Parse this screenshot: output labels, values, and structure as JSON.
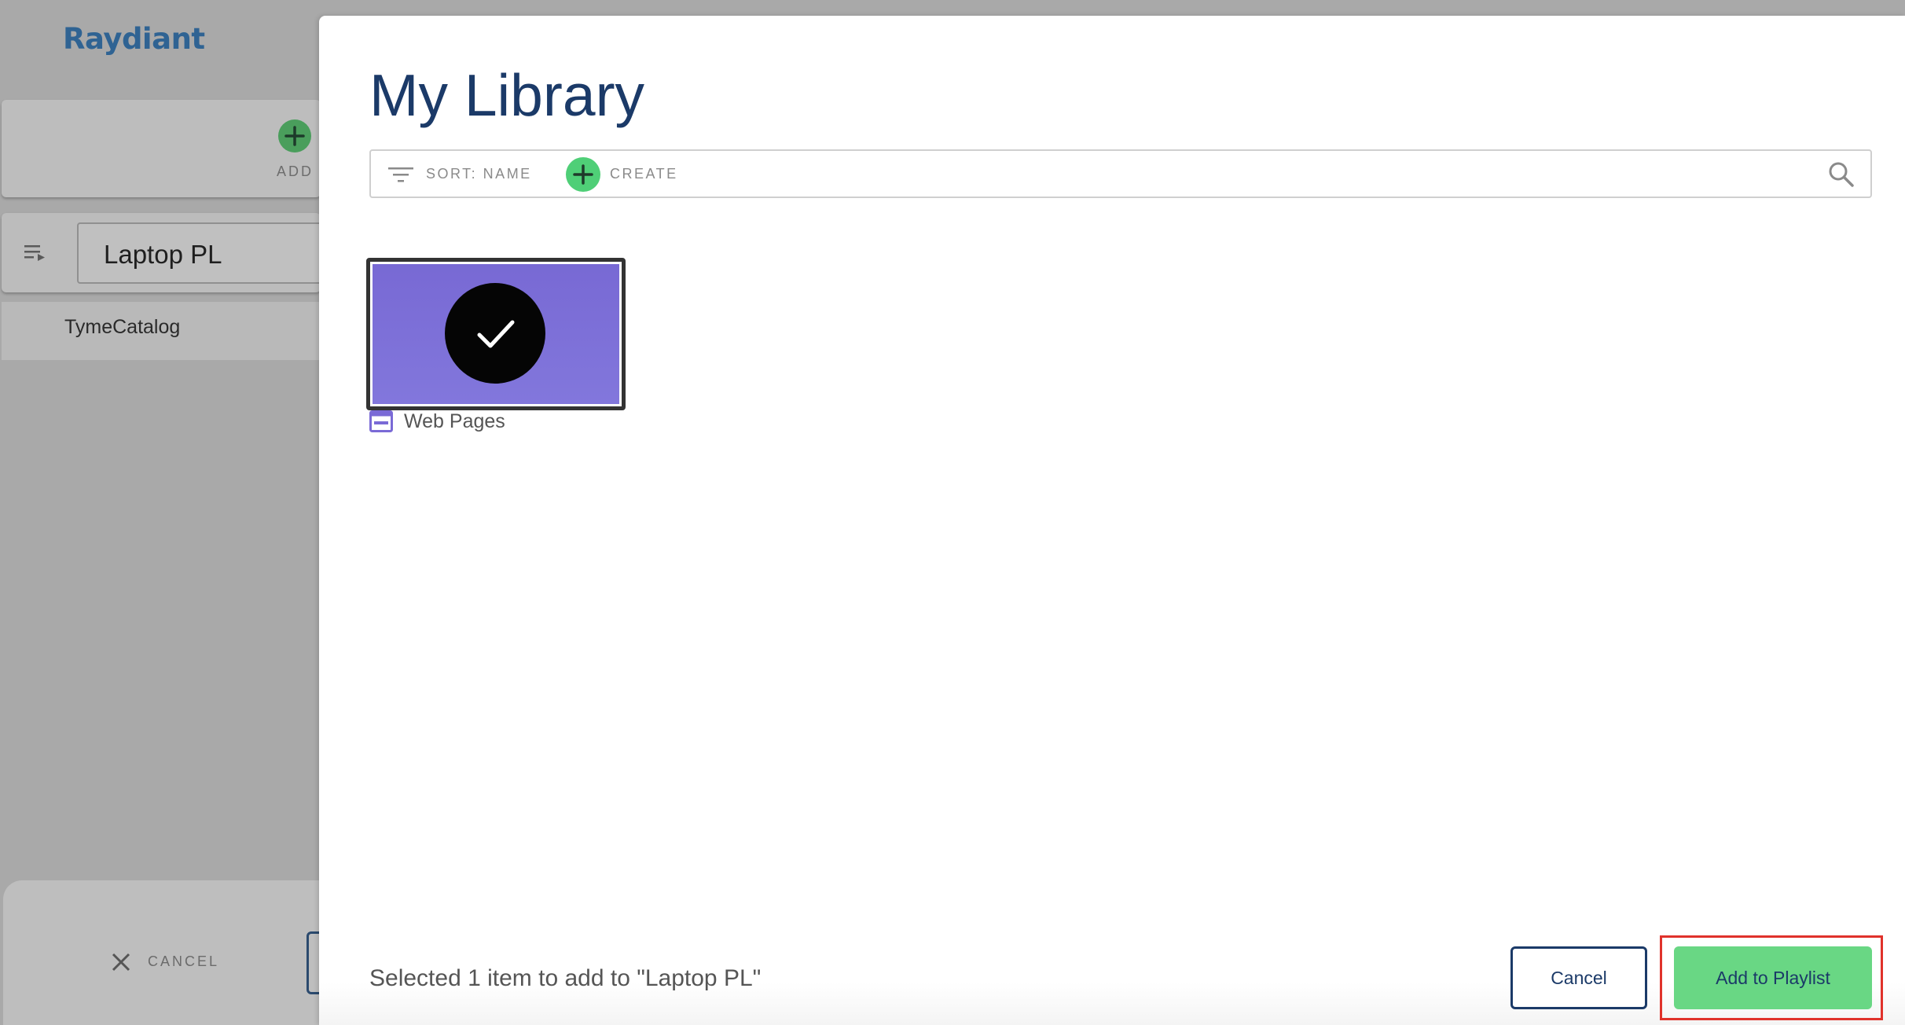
{
  "app": {
    "brand": "Raydiant"
  },
  "background": {
    "add_label": "ADD",
    "playlist_name": "Laptop PL",
    "playlist_items": [
      "TymeCatalog"
    ],
    "cancel_label": "CANCEL"
  },
  "modal": {
    "title": "My Library",
    "toolbar": {
      "sort_label": "SORT: NAME",
      "create_label": "CREATE"
    },
    "items": [
      {
        "label": "Web Pages",
        "selected": true,
        "type_icon": "web-page-icon",
        "color": "#7869d4"
      }
    ],
    "status": "Selected 1 item to add to \"Laptop PL\"",
    "cancel_button": "Cancel",
    "add_button": "Add to Playlist"
  },
  "colors": {
    "brand": "#2f6393",
    "primary_navy": "#1b3a68",
    "accent_green": "#69d784",
    "create_green": "#4fcf77",
    "highlight_red": "#e0322b"
  }
}
